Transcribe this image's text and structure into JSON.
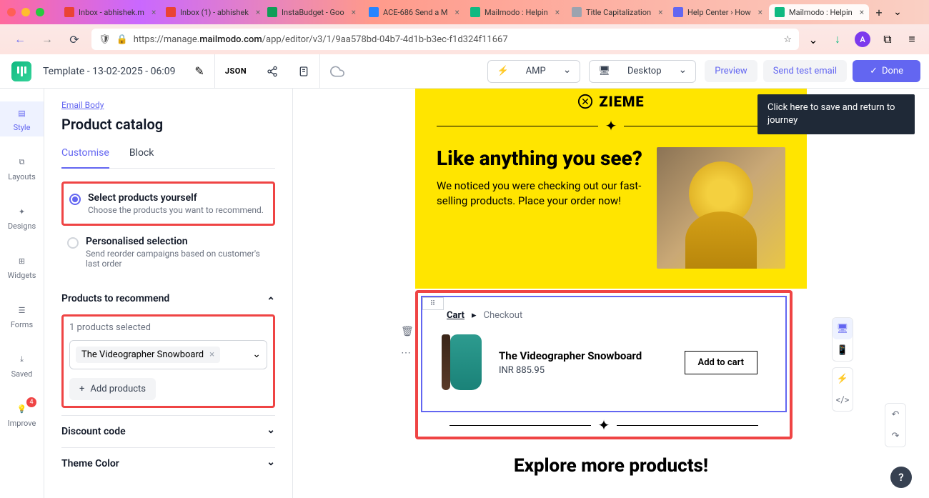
{
  "browser": {
    "tabs": [
      {
        "label": "Inbox - abhishek.m",
        "favicon": "#ea4335"
      },
      {
        "label": "Inbox (1) - abhishek",
        "favicon": "#ea4335"
      },
      {
        "label": "InstaBudget - Goo",
        "favicon": "#0f9d58"
      },
      {
        "label": "ACE-686 Send a M",
        "favicon": "#2684ff"
      },
      {
        "label": "Mailmodo : Helpin",
        "favicon": "#10b981"
      },
      {
        "label": "Title Capitalization",
        "favicon": "#9ca3af"
      },
      {
        "label": "Help Center › How",
        "favicon": "#6366f1"
      },
      {
        "label": "Mailmodo : Helpin",
        "favicon": "#10b981",
        "active": true
      }
    ],
    "url_prefix": "https://manage.",
    "url_domain": "mailmodo.com",
    "url_path": "/app/editor/v3/1/9aa578bd-04b7-4d1b-b3ec-f1d324f11667",
    "avatar_initial": "A"
  },
  "header": {
    "template_name": "Template - 13-02-2025 - 06:09",
    "json_label": "JSON",
    "amp_label": "AMP",
    "desktop_label": "Desktop",
    "preview": "Preview",
    "send_test": "Send test email",
    "done": "Done"
  },
  "tooltip": "Click here to save and return to journey",
  "rail": {
    "items": [
      "Style",
      "Layouts",
      "Designs",
      "Widgets",
      "Forms",
      "Saved",
      "Improve"
    ],
    "improve_badge": "4"
  },
  "sidebar": {
    "breadcrumb": "Email Body",
    "title": "Product catalog",
    "tabs": {
      "customise": "Customise",
      "block": "Block"
    },
    "option1": {
      "title": "Select products yourself",
      "desc": "Choose the products you want to recommend."
    },
    "option2": {
      "title": "Personalised selection",
      "desc": "Send reorder campaigns based on customer's last order"
    },
    "products_header": "Products to recommend",
    "products_count": "1 products selected",
    "product_chip": "The Videographer Snowboard",
    "add_products": "Add products",
    "discount_header": "Discount code",
    "theme_header": "Theme Color"
  },
  "email": {
    "brand": "ZIEME",
    "hero_title": "Like anything you see?",
    "hero_desc": "We noticed you were checking out our fast-selling products. Place your order now!",
    "cart_label": "Cart",
    "checkout_label": "Checkout",
    "product_title": "The Videographer Snowboard",
    "product_price": "INR 885.95",
    "add_to_cart": "Add to cart",
    "explore": "Explore more products!"
  }
}
